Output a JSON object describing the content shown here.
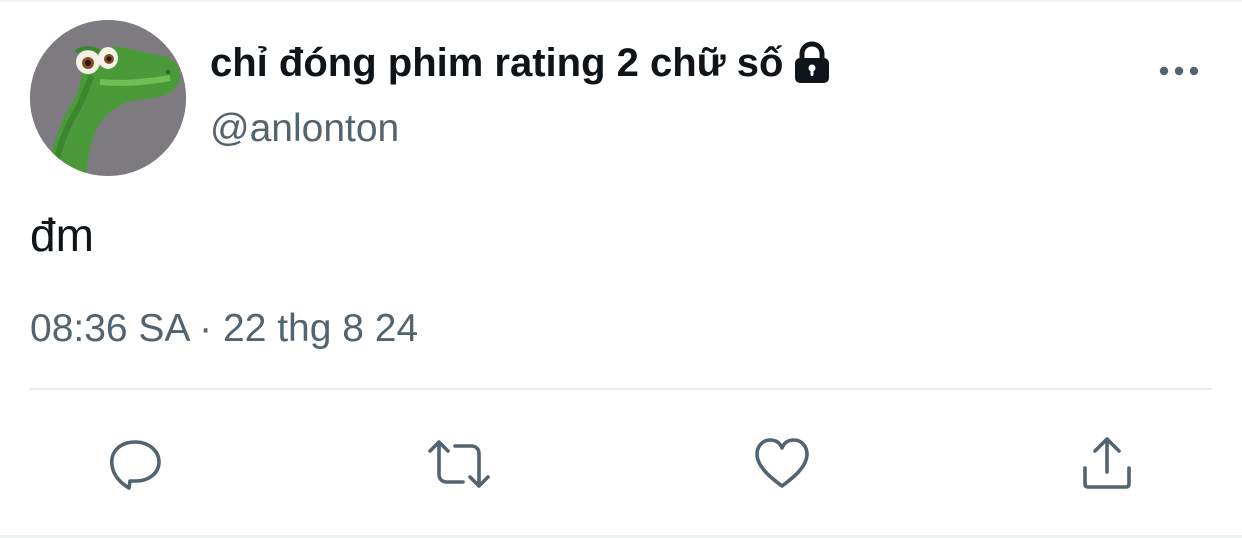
{
  "tweet": {
    "author": {
      "display_name": "chỉ đóng phim rating 2 chữ số",
      "handle": "@anlonton",
      "protected_icon": "lock-icon",
      "avatar": "avatar-image"
    },
    "text": "đm",
    "time": "08:36 SA",
    "separator": "·",
    "date": "22 thg 8 24",
    "more_icon": "more-horizontal-icon"
  },
  "actions": [
    {
      "name": "reply",
      "icon": "reply-icon"
    },
    {
      "name": "retweet",
      "icon": "retweet-icon"
    },
    {
      "name": "like",
      "icon": "heart-icon"
    },
    {
      "name": "share",
      "icon": "share-icon"
    }
  ],
  "colors": {
    "primary_text": "#0f1419",
    "secondary_text": "#536471",
    "icon": "#536471",
    "divider": "#e6ecf0"
  }
}
